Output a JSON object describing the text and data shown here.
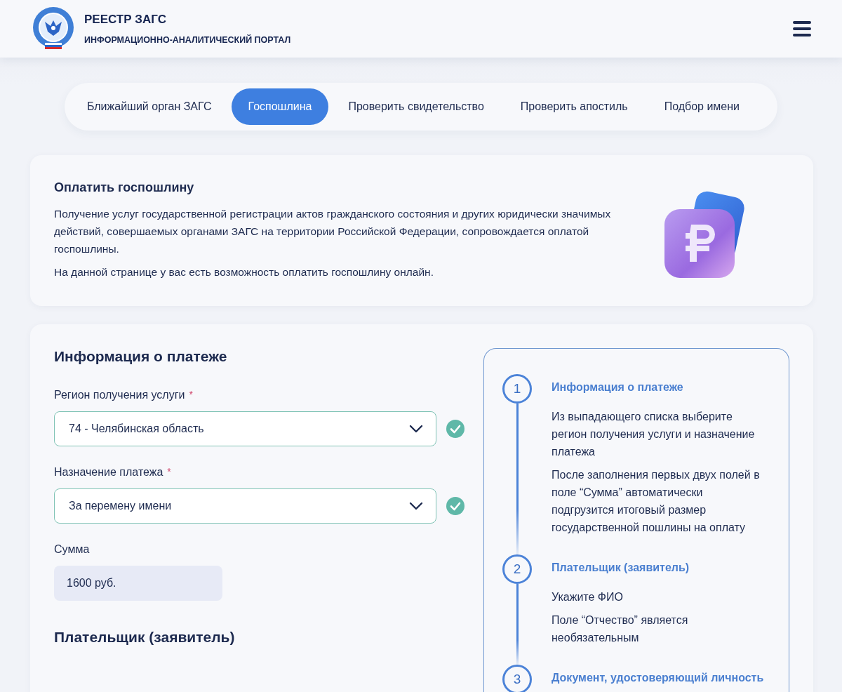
{
  "header": {
    "title": "РЕЕСТР ЗАГС",
    "subtitle": "ИНФОРМАЦИОННО-АНАЛИТИЧЕСКИЙ ПОРТАЛ"
  },
  "tabs": [
    {
      "label": "Ближайший орган ЗАГС",
      "selected": false
    },
    {
      "label": "Госпошлина",
      "selected": true
    },
    {
      "label": "Проверить свидетельство",
      "selected": false
    },
    {
      "label": "Проверить апостиль",
      "selected": false
    },
    {
      "label": "Подбор имени",
      "selected": false
    }
  ],
  "intro": {
    "title": "Оплатить госпошлину",
    "paragraphs": [
      "Получение услуг государственной регистрации актов гражданского состояния и других юридически значимых действий, совершаемых органами ЗАГС на территории Российской Федерации, сопровождается оплатой госпошлины.",
      "На данной странице у вас есть возможность оплатить госпошлину онлайн."
    ]
  },
  "form": {
    "title": "Информация о платеже",
    "fields": [
      {
        "kind": "select",
        "label": "Регион получения услуги",
        "required_mark": "*",
        "value": "74 - Челябинская область",
        "valid": true
      },
      {
        "kind": "select",
        "label": "Назначение платежа",
        "required_mark": "*",
        "value": "За перемену имени",
        "valid": true
      },
      {
        "kind": "readonly",
        "label": "Сумма",
        "value": "1600 руб."
      }
    ],
    "next_title": "Плательщик (заявитель)"
  },
  "steps": [
    {
      "number": "1",
      "title": "Информация о платеже",
      "paragraphs": [
        "Из выпадающего списка выберите регион получения услуги и назначение платежа",
        "После заполнения первых двух полей в поле “Сумма” автоматически подгрузится итоговый размер государственной пошлины на оплату"
      ]
    },
    {
      "number": "2",
      "title": "Плательщик (заявитель)",
      "paragraphs": [
        "Укажите ФИО",
        "Поле “Отчество” является необязательным"
      ]
    },
    {
      "number": "3",
      "title": "Документ, удостоверяющий личность"
    }
  ]
}
